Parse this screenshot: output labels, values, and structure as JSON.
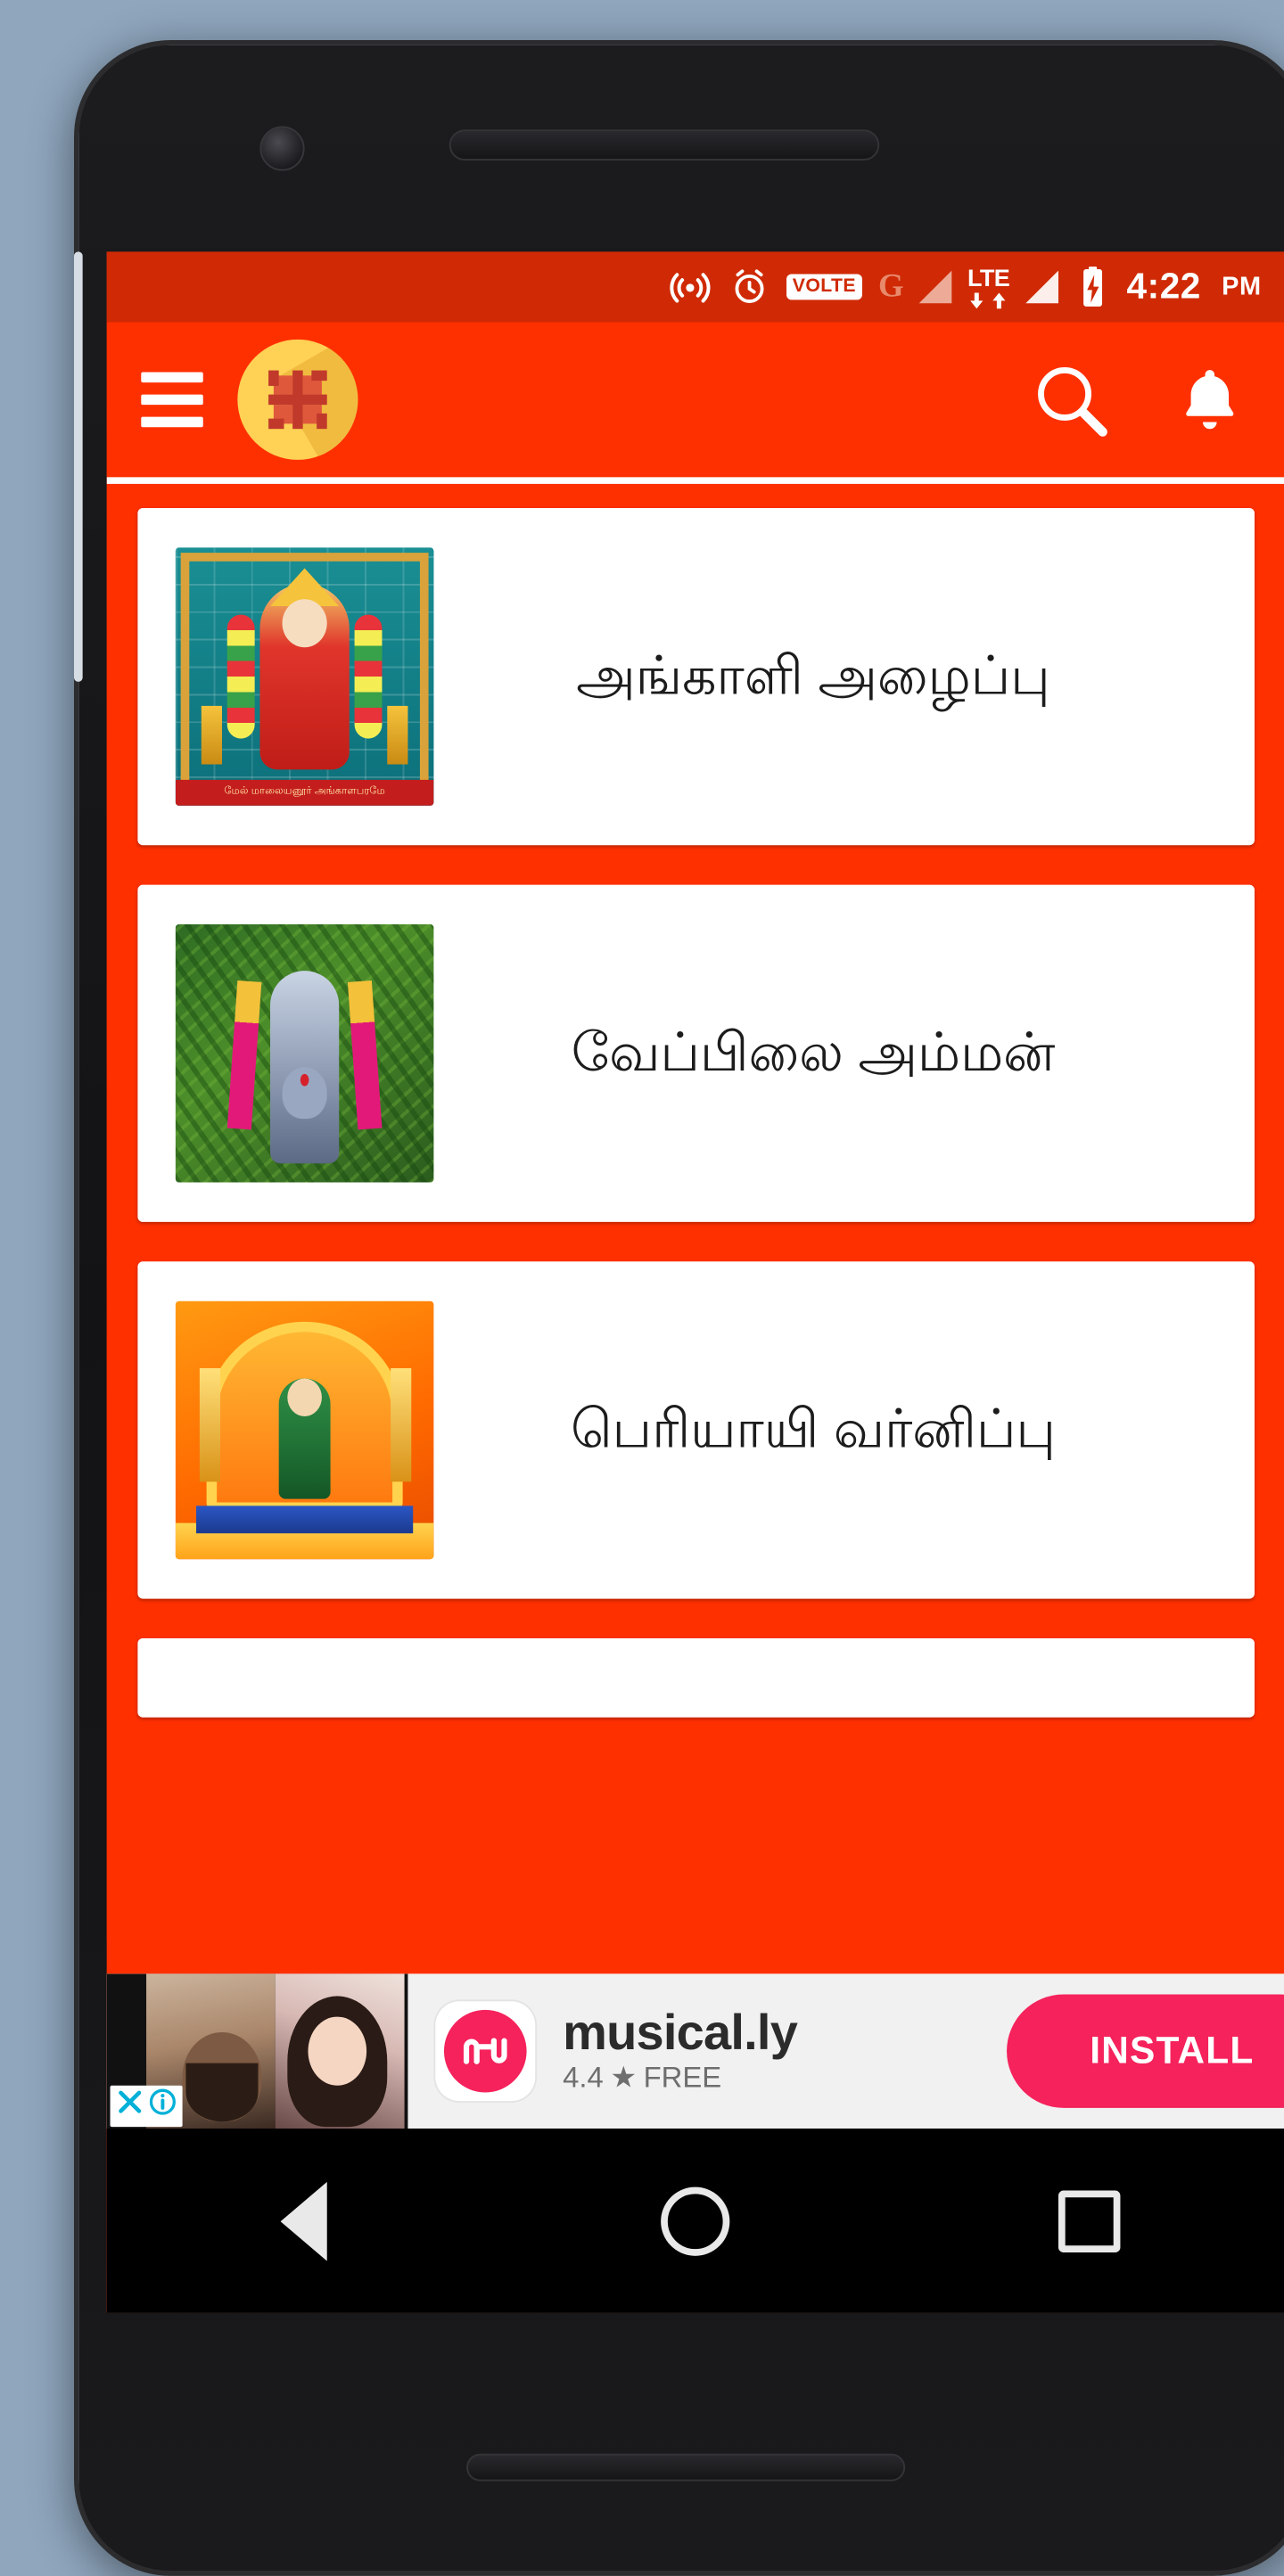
{
  "device": {
    "type": "android-phone",
    "frame_color": "#1c1c1e"
  },
  "status_bar": {
    "background": "#cf2a05",
    "time": "4:22",
    "am_pm": "PM",
    "icons": [
      {
        "name": "cast-screen-icon",
        "label": "cast"
      },
      {
        "name": "alarm-clock-icon",
        "label": "alarm"
      },
      {
        "name": "volte-badge",
        "label": "VOLTE"
      },
      {
        "name": "gprs-icon",
        "label": "G"
      },
      {
        "name": "signal-bars-sim1-icon",
        "label": "signal 1"
      },
      {
        "name": "lte-data-icon",
        "label": "LTE"
      },
      {
        "name": "signal-bars-sim2-icon",
        "label": "signal 2"
      },
      {
        "name": "battery-charging-icon",
        "label": "battery charging"
      }
    ]
  },
  "app_bar": {
    "background": "#ff3000",
    "menu_label": "Menu",
    "logo_label": "swastika-logo",
    "search_label": "Search",
    "notifications_label": "Notifications"
  },
  "list": {
    "items": [
      {
        "title": "அங்காளி அழைப்பு",
        "thumb": "angali-amman-temple-deity",
        "thumb_caption": "மேல் மாலையனூர் அங்காளபரமே"
      },
      {
        "title": "வேப்பிலை அம்மன்",
        "thumb": "veppilai-amman-neem-deity"
      },
      {
        "title": "பெரியாயி வர்னிப்பு",
        "thumb": "periyayi-amman-shrine"
      }
    ]
  },
  "ad": {
    "title": "musical.ly",
    "rating": "4.4",
    "star": "★",
    "price_label": "FREE",
    "install_label": "INSTALL",
    "close_label": "✕",
    "info_label": "i",
    "accent": "#f5225c"
  },
  "nav_bar": {
    "back_label": "Back",
    "home_label": "Home",
    "recents_label": "Recent apps"
  }
}
